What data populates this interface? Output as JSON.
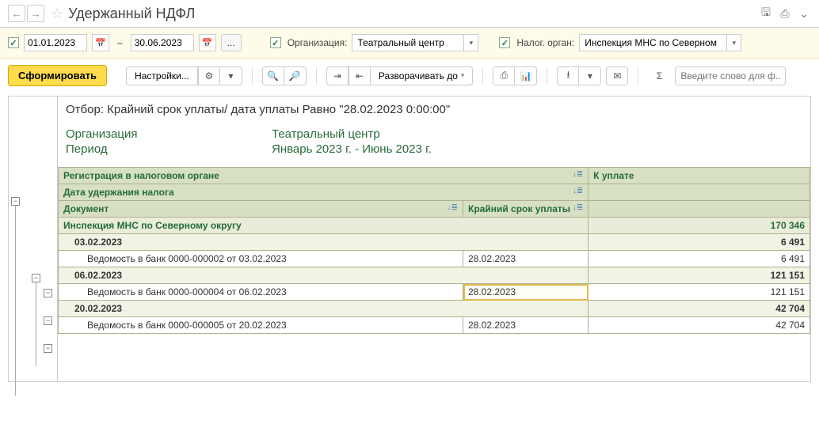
{
  "title": "Удержанный НДФЛ",
  "filters": {
    "date_from": "01.01.2023",
    "date_to": "30.06.2023",
    "org_label": "Организация:",
    "org_value": "Театральный центр",
    "tax_label": "Налог. орган:",
    "tax_value": "Инспекция МНС по Северном"
  },
  "toolbar": {
    "generate": "Сформировать",
    "settings": "Настройки...",
    "expand": "Разворачивать до",
    "search_placeholder": "Введите слово для ф..."
  },
  "report": {
    "filter_text": "Отбор: Крайний срок уплаты/ дата уплаты Равно \"28.02.2023 0:00:00\"",
    "org_label": "Организация",
    "org_value": "Театральный центр",
    "period_label": "Период",
    "period_value": "Январь 2023 г. - Июнь 2023 г.",
    "headers": {
      "reg": "Регистрация в налоговом органе",
      "k_uplate": "К уплате",
      "date_hold": "Дата удержания налога",
      "document": "Документ",
      "deadline": "Крайний срок уплаты"
    },
    "rows": {
      "total_name": "Инспекция МНС по Северному округу",
      "total_val": "170 346",
      "g1_date": "03.02.2023",
      "g1_val": "6 491",
      "g1_doc": "Ведомость в банк 0000-000002 от 03.02.2023",
      "g1_deadline": "28.02.2023",
      "g1_doc_val": "6 491",
      "g2_date": "06.02.2023",
      "g2_val": "121 151",
      "g2_doc": "Ведомость в банк 0000-000004 от 06.02.2023",
      "g2_deadline": "28.02.2023",
      "g2_doc_val": "121 151",
      "g3_date": "20.02.2023",
      "g3_val": "42 704",
      "g3_doc": "Ведомость в банк 0000-000005 от 20.02.2023",
      "g3_deadline": "28.02.2023",
      "g3_doc_val": "42 704"
    }
  }
}
